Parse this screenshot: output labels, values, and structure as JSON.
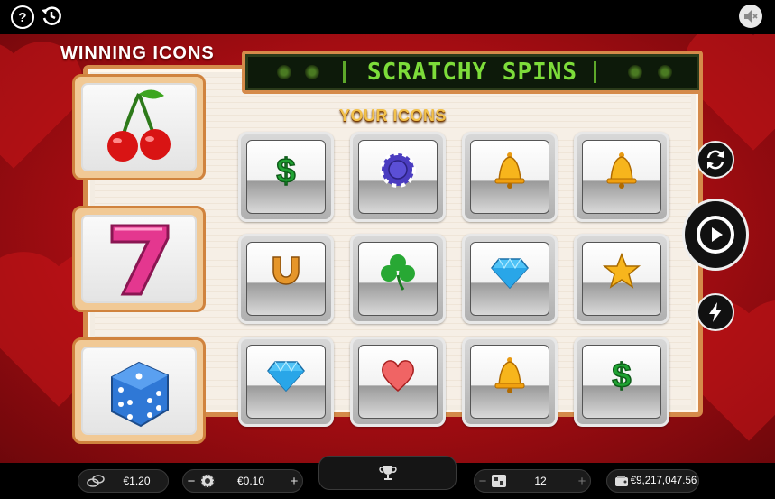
{
  "topbar": {
    "help_label": "?",
    "history_icon": "history-icon",
    "sound_icon": "speaker-muted-icon"
  },
  "game": {
    "winning_title": "WINNING ICONS",
    "marquee_title": "SCRATCHY SPINS",
    "your_icons_title": "YOUR ICONS",
    "winning_icons": [
      "cherries",
      "seven",
      "dice"
    ],
    "your_icons": [
      [
        "dollar",
        "poker-chip",
        "bell",
        "bell"
      ],
      [
        "horseshoe",
        "clover",
        "diamond",
        "star"
      ],
      [
        "diamond",
        "heart",
        "bell",
        "dollar"
      ]
    ]
  },
  "side_controls": {
    "autoplay_icon": "refresh-icon",
    "play_icon": "play-icon",
    "turbo_icon": "lightning-icon"
  },
  "bottombar": {
    "total_bet": "€1.20",
    "bet_value": "€0.10",
    "lines": "12",
    "balance": "€9,217,047.56",
    "minus": "−",
    "plus": "+"
  },
  "colors": {
    "background_red": "#a40d12",
    "frame_orange": "#d58a4a",
    "marquee_green": "#7ddc3a",
    "title_gold": "#f2c14b"
  }
}
